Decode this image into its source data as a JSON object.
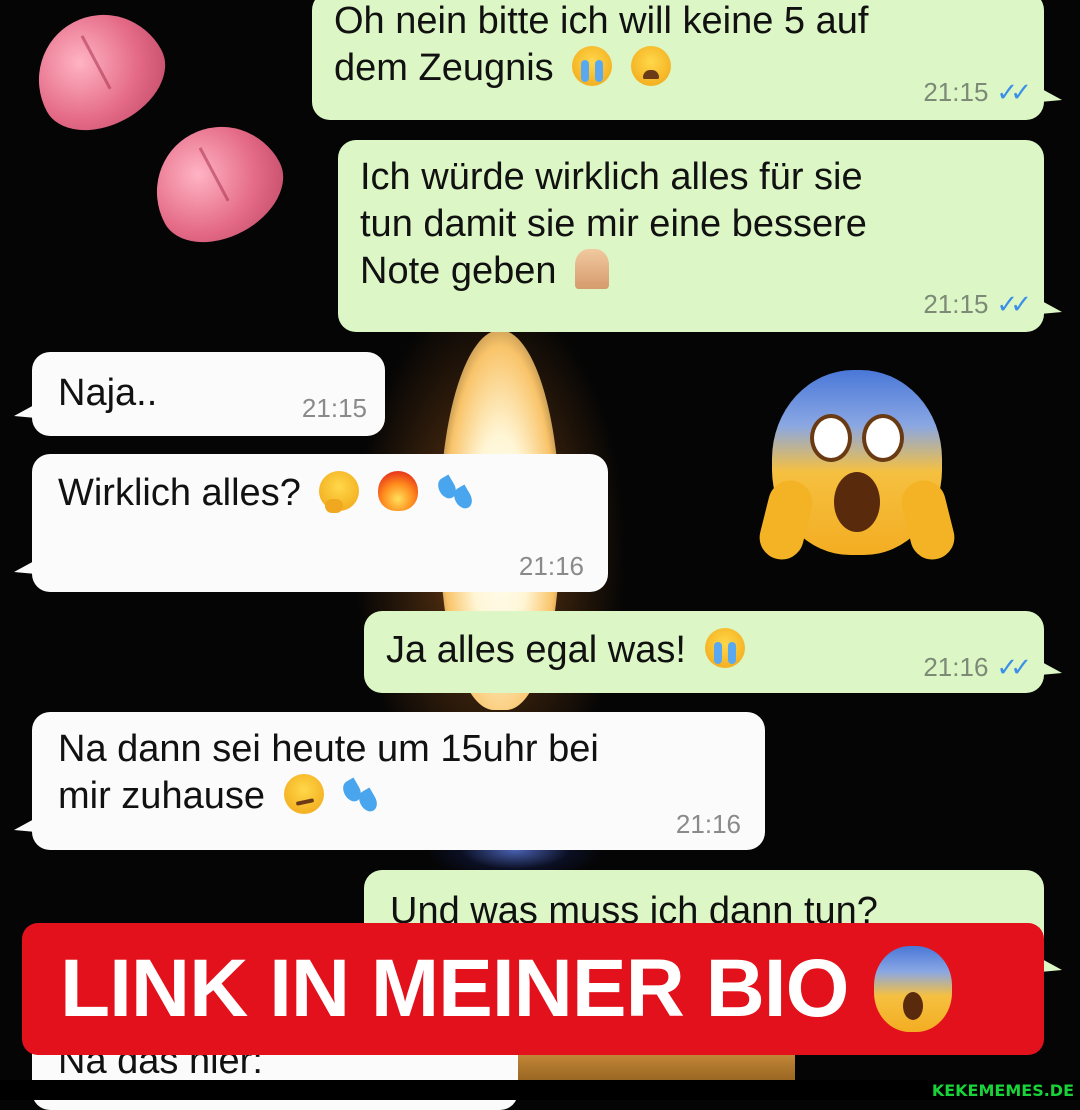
{
  "messages": [
    {
      "id": "m1",
      "direction": "out",
      "text": "Oh nein bitte ich will keine 5 auf dem Zeugnis",
      "emojis": [
        "loudly-crying-face",
        "weary-face"
      ],
      "time": "21:15",
      "read": true
    },
    {
      "id": "m2",
      "direction": "out",
      "text": "Ich würde wirklich alles für sie tun damit sie mir eine bessere Note geben",
      "emojis": [
        "folded-hands"
      ],
      "time": "21:15",
      "read": true
    },
    {
      "id": "m3",
      "direction": "in",
      "text": "Naja..",
      "emojis": [],
      "time": "21:15"
    },
    {
      "id": "m4",
      "direction": "in",
      "text": "Wirklich alles?",
      "emojis": [
        "thinking-face",
        "fire",
        "sweat-droplets"
      ],
      "time": "21:16"
    },
    {
      "id": "m5",
      "direction": "out",
      "text": "Ja alles egal was!",
      "emojis": [
        "loudly-crying-face"
      ],
      "time": "21:16",
      "read": true
    },
    {
      "id": "m6",
      "direction": "in",
      "text": "Na dann sei heute um 15uhr bei mir zuhause",
      "emojis": [
        "smirking-face",
        "sweat-droplets"
      ],
      "time": "21:16"
    },
    {
      "id": "m7",
      "direction": "out",
      "text": "Und was muss ich dann tun?",
      "emojis": []
    },
    {
      "id": "m8",
      "direction": "in",
      "text": "Na das hier:"
    }
  ],
  "line_parts": {
    "m1_l1": "Oh nein bitte ich will keine 5 auf",
    "m1_l2": "dem Zeugnis",
    "m2_l1": "Ich würde wirklich alles für sie",
    "m2_l2": "tun damit sie mir eine bessere",
    "m2_l3": "Note geben",
    "m6_l1": "Na dann sei heute um 15uhr bei",
    "m6_l2": "mir zuhause"
  },
  "read_ticks": "✓✓",
  "overlay_decorations": [
    "tongue-emoji",
    "tongue-emoji",
    "face-screaming-in-fear"
  ],
  "banner": {
    "text": "LINK IN MEINER BIO",
    "emoji": "face-screaming-in-fear"
  },
  "watermark": "KEKEMEMES.DE",
  "colors": {
    "outgoing_bubble": "#dcf7c5",
    "incoming_bubble": "#fbfbfb",
    "read_ticks": "#3b8fe8",
    "banner_bg": "#e3111b",
    "watermark": "#19d23a"
  }
}
